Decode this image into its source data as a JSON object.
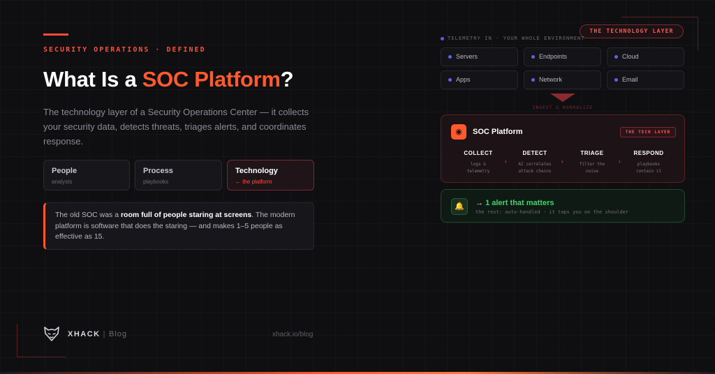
{
  "left": {
    "eyebrow": "SECURITY OPERATIONS · DEFINED",
    "title_pre": "What Is a ",
    "title_hl": "SOC Platform",
    "title_post": "?",
    "description": "The technology layer of a Security Operations Center — it collects your security data, detects threats, triages alerts, and coordinates response.",
    "pills": [
      {
        "title": "People",
        "sub": "analysts"
      },
      {
        "title": "Process",
        "sub": "playbooks"
      },
      {
        "title": "Technology",
        "sub": "← the platform"
      }
    ],
    "quote": {
      "pre": "The old SOC was a ",
      "bold": "room full of people staring at screens",
      "post": ". The modern platform is software that does the staring — and makes 1–5 people as effective as 15."
    }
  },
  "footer": {
    "brand": "XHACK",
    "sep": "|",
    "section": "Blog",
    "url": "xhack.io/blog"
  },
  "right": {
    "badge": "THE TECHNOLOGY LAYER",
    "telemetry_label": "TELEMETRY IN · YOUR WHOLE ENVIRONMENT",
    "sources": [
      "Servers",
      "Endpoints",
      "Cloud",
      "Apps",
      "Network",
      "Email"
    ],
    "ingest_label": "INGEST & NORMALIZE",
    "platform": {
      "title": "SOC Platform",
      "tag": "THE TECH LAYER",
      "stages": [
        {
          "name": "COLLECT",
          "l1": "logs &",
          "l2": "telemetry"
        },
        {
          "name": "DETECT",
          "l1": "AI correlates",
          "l2": "attack chains"
        },
        {
          "name": "TRIAGE",
          "l1": "filter the",
          "l2": "noise"
        },
        {
          "name": "RESPOND",
          "l1": "playbooks",
          "l2": "contain it"
        }
      ]
    },
    "alert": {
      "arrow": "→",
      "title": "1 alert that matters",
      "sub": "the rest: auto-handled · it taps you on the shoulder"
    }
  },
  "colors": {
    "accent": "#ff5a2e",
    "alert_green": "#3fd36a",
    "source_dot": "#6063e8"
  }
}
